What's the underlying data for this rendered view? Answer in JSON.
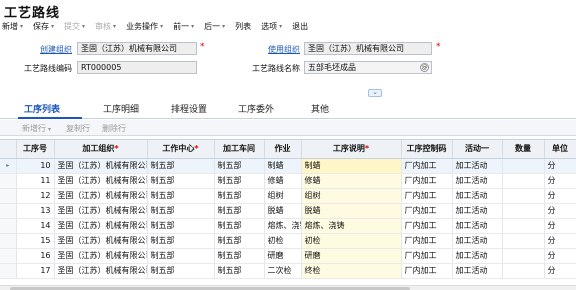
{
  "page": {
    "title": "工艺路线"
  },
  "toolbar": {
    "items": [
      {
        "label": "新增",
        "caret": "▾",
        "enabled": true
      },
      {
        "label": "保存",
        "caret": "▾",
        "enabled": true
      },
      {
        "label": "提交",
        "caret": "▾",
        "enabled": false
      },
      {
        "label": "审核",
        "caret": "▾",
        "enabled": false
      },
      {
        "label": "业务操作",
        "caret": "▾",
        "enabled": true
      },
      {
        "label": "前一",
        "caret": "▾",
        "enabled": true
      },
      {
        "label": "后一",
        "caret": "▾",
        "enabled": true
      },
      {
        "label": "列表",
        "caret": "",
        "enabled": true
      },
      {
        "label": "选项",
        "caret": "▾",
        "enabled": true
      },
      {
        "label": "退出",
        "caret": "",
        "enabled": true
      }
    ]
  },
  "form": {
    "create_org": {
      "label": "创建组织",
      "value": "圣固（江苏）机械有限公司",
      "required": "*"
    },
    "route_code": {
      "label": "工艺路线编码",
      "value": "RT000005"
    },
    "use_org": {
      "label": "使用组织",
      "value": "圣固（江苏）机械有限公司",
      "required": "*"
    },
    "route_name": {
      "label": "工艺路线名称",
      "value": "五部毛坯成品",
      "lookup": "@"
    }
  },
  "collapse_symbol": "⌄",
  "tabs": [
    {
      "label": "工序列表",
      "active": true
    },
    {
      "label": "工序明细",
      "active": false
    },
    {
      "label": "排程设置",
      "active": false
    },
    {
      "label": "工序委外",
      "active": false
    },
    {
      "label": "其他",
      "active": false
    }
  ],
  "subbar": {
    "add_row": "新增行",
    "add_row_caret": "▾",
    "copy_row": "复制行",
    "delete_row": "删除行"
  },
  "grid": {
    "columns": [
      {
        "label": "",
        "required": ""
      },
      {
        "label": "工序号",
        "required": ""
      },
      {
        "label": "加工组织",
        "required": "*"
      },
      {
        "label": "工作中心",
        "required": "*"
      },
      {
        "label": "加工车间",
        "required": ""
      },
      {
        "label": "作业",
        "required": ""
      },
      {
        "label": "工序说明",
        "required": "*"
      },
      {
        "label": "工序控制码",
        "required": ""
      },
      {
        "label": "活动一",
        "required": ""
      },
      {
        "label": "数量",
        "required": ""
      },
      {
        "label": "单位",
        "required": ""
      }
    ],
    "selected_row_marker": "▸",
    "rows": [
      {
        "seq": "10",
        "org": "圣固（江苏）机械有限公司",
        "wc": "制五部",
        "shop": "制五部",
        "job": "制蜡",
        "desc": "制蜡",
        "ctrl": "厂内加工",
        "act": "加工活动",
        "qty": "",
        "unit": "分"
      },
      {
        "seq": "11",
        "org": "圣固（江苏）机械有限公司",
        "wc": "制五部",
        "shop": "制五部",
        "job": "修蜡",
        "desc": "修蜡",
        "ctrl": "厂内加工",
        "act": "加工活动",
        "qty": "",
        "unit": "分"
      },
      {
        "seq": "12",
        "org": "圣固（江苏）机械有限公司",
        "wc": "制五部",
        "shop": "制五部",
        "job": "组树",
        "desc": "组树",
        "ctrl": "厂内加工",
        "act": "加工活动",
        "qty": "",
        "unit": "分"
      },
      {
        "seq": "13",
        "org": "圣固（江苏）机械有限公司",
        "wc": "制五部",
        "shop": "制五部",
        "job": "脱蜡",
        "desc": "脱蜡",
        "ctrl": "厂内加工",
        "act": "加工活动",
        "qty": "",
        "unit": "分"
      },
      {
        "seq": "14",
        "org": "圣固（江苏）机械有限公司",
        "wc": "制五部",
        "shop": "制五部",
        "job": "熔炼、浇铸",
        "desc": "熔炼、浇铸",
        "ctrl": "厂内加工",
        "act": "加工活动",
        "qty": "",
        "unit": "分"
      },
      {
        "seq": "15",
        "org": "圣固（江苏）机械有限公司",
        "wc": "制五部",
        "shop": "制五部",
        "job": "初检",
        "desc": "初检",
        "ctrl": "厂内加工",
        "act": "加工活动",
        "qty": "",
        "unit": "分"
      },
      {
        "seq": "16",
        "org": "圣固（江苏）机械有限公司",
        "wc": "制五部",
        "shop": "制五部",
        "job": "研磨",
        "desc": "研磨",
        "ctrl": "厂内加工",
        "act": "加工活动",
        "qty": "",
        "unit": "分"
      },
      {
        "seq": "17",
        "org": "圣固（江苏）机械有限公司",
        "wc": "制五部",
        "shop": "制五部",
        "job": "二次检",
        "desc": "终检",
        "ctrl": "厂内加工",
        "act": "加工活动",
        "qty": "",
        "unit": "分"
      }
    ]
  }
}
